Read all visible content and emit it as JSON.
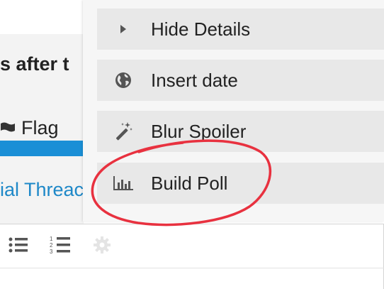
{
  "background": {
    "post_title_fragment": "s after t",
    "flag_label": "Flag",
    "thread_link_fragment": "ial Threac"
  },
  "menu": {
    "items": [
      {
        "label": "Hide Details",
        "icon": "caret-right-icon"
      },
      {
        "label": "Insert date",
        "icon": "globe-icon"
      },
      {
        "label": "Blur Spoiler",
        "icon": "magic-wand-icon"
      },
      {
        "label": "Build Poll",
        "icon": "bar-chart-icon"
      }
    ]
  },
  "toolbar": {
    "icons": [
      "bullet-list-icon",
      "numbered-list-icon",
      "gear-icon"
    ]
  },
  "colors": {
    "menu_bg": "#f6f6f6",
    "menu_item_bg": "#e8e8e8",
    "accent_blue": "#1a8fd6",
    "annotation_red": "#e8313f"
  }
}
